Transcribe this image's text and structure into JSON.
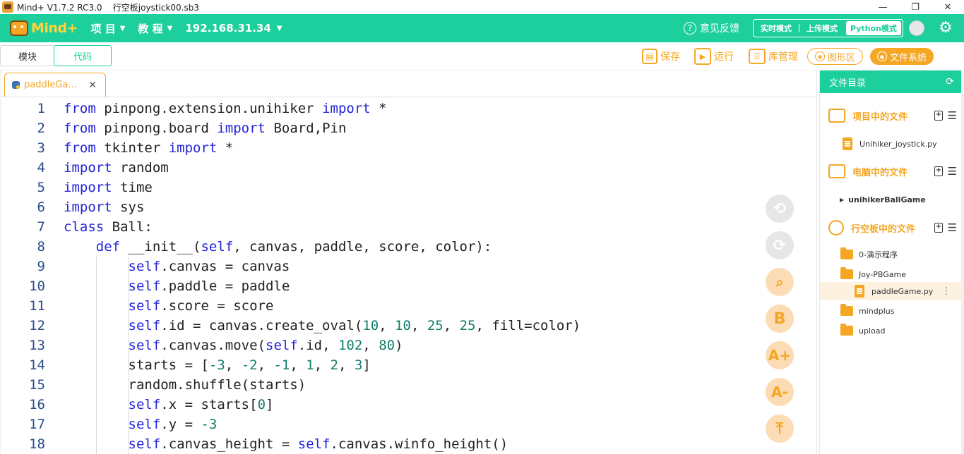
{
  "titlebar": {
    "title": "Mind+ V1.7.2 RC3.0    行空板joystick00.sb3",
    "minimize": "—",
    "restore": "❐",
    "close": "✕"
  },
  "menubar": {
    "logo": {
      "mind": "Mind",
      "plus": "+"
    },
    "items": [
      {
        "label": "项 目"
      },
      {
        "label": "教 程"
      }
    ],
    "ip": "192.168.31.34",
    "feedback": "意见反馈",
    "modes": [
      "实时模式",
      "上传模式",
      "Python模式"
    ],
    "active_mode": "Python模式"
  },
  "toolbar": {
    "tab_blocks": "模块",
    "tab_code": "代码",
    "save": "保存",
    "run": "运行",
    "lib": "库管理",
    "graph": "图形区",
    "fs": "文件系统"
  },
  "editor": {
    "tab_label": "paddleGa...",
    "tab_close": "✕",
    "lines": [
      "from pinpong.extension.unihiker import *",
      "from pinpong.board import Board,Pin",
      "from tkinter import *",
      "import random",
      "import time",
      "import sys",
      "class Ball:",
      "    def __init__(self, canvas, paddle, score, color):",
      "        self.canvas = canvas",
      "        self.paddle = paddle",
      "        self.score = score",
      "        self.id = canvas.create_oval(10, 10, 25, 25, fill=color)",
      "        self.canvas.move(self.id, 102, 80)",
      "        starts = [-3, -2, -1, 1, 2, 3]",
      "        random.shuffle(starts)",
      "        self.x = starts[0]",
      "        self.y = -3",
      "        self.canvas_height = self.canvas.winfo_height()"
    ]
  },
  "fabs": {
    "undo": "⟲",
    "redo": "⟳",
    "search": "🔍",
    "format": "B",
    "font_up": "A+",
    "font_down": "A-",
    "top": "⤒"
  },
  "sidebar": {
    "title": "文件目录",
    "sections": {
      "project": "项目中的文件",
      "pc": "电脑中的文件",
      "board": "行空板中的文件"
    },
    "project_files": [
      "Unihiker_joystick.py"
    ],
    "pc_files": [
      "unihikerBallGame"
    ],
    "board_files": [
      "0-演示程序",
      "Joy-PBGame",
      "paddleGame.py",
      "mindplus",
      "upload"
    ]
  },
  "colors": {
    "accent": "#1dcf9c",
    "orange": "#f5a623"
  }
}
